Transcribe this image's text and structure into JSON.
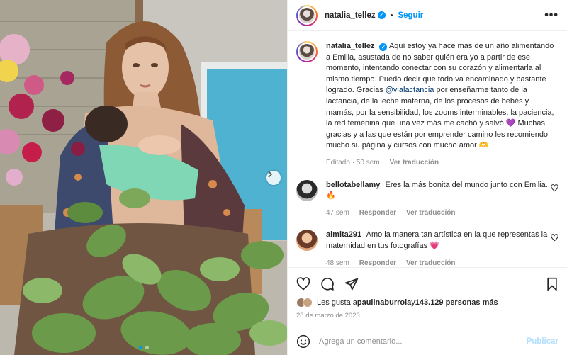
{
  "post": {
    "author": "natalia_tellez",
    "follow_label": "Seguir",
    "separator": "•",
    "more_label": "•••"
  },
  "caption": {
    "author": "natalia_tellez",
    "text_before": "Aquí estoy ya hace más de un año alimentando a Emilia, asustada de no saber quién era yo a partir de ese momento, intentando conectar con su corazón y alimentarla al mismo tiempo. Puedo decir que todo va encaminado y bastante logrado. Gracias ",
    "mention": "@vialactancia",
    "text_after": " por enseñarme tanto de la lactancia, de la leche materna, de los procesos de bebés y mamás, por la sensibilidad, los zooms interminables, la paciencia, la red femenina que una vez más me cachó y salvó 💜 Muchas gracias y a las que están por emprender camino les recomiendo mucho su página y cursos con mucho amor 🫶",
    "edited": "Editado · 50 sem",
    "see_translation": "Ver traducción"
  },
  "comments": [
    {
      "author": "bellotabellamy",
      "text": "Eres la más bonita del mundo junto con Emilia. 🔥",
      "age": "47 sem",
      "reply": "Responder",
      "see_translation": "Ver traducción"
    },
    {
      "author": "almita291",
      "text": "Amo la manera tan artística en la que representas la maternidad en tus fotografías 💗",
      "age": "48 sem",
      "reply": "Responder",
      "see_translation": "Ver traducción"
    }
  ],
  "likes": {
    "prefix": "Les gusta a ",
    "user": "paulinaburrola",
    "middle": " y ",
    "count": "143.129 personas más"
  },
  "date": "28 de marzo de 2023",
  "add_comment": {
    "placeholder": "Agrega un comentario...",
    "publish_label": "Publicar"
  },
  "icons": {
    "like": "heart-icon",
    "comment": "comment-icon",
    "share": "send-icon",
    "save": "bookmark-icon",
    "emoji": "emoji-icon",
    "next": "chevron-right-icon"
  },
  "colors": {
    "accent": "#0095f6",
    "publish_disabled": "#b2dffc",
    "muted": "#8e8e8e"
  }
}
